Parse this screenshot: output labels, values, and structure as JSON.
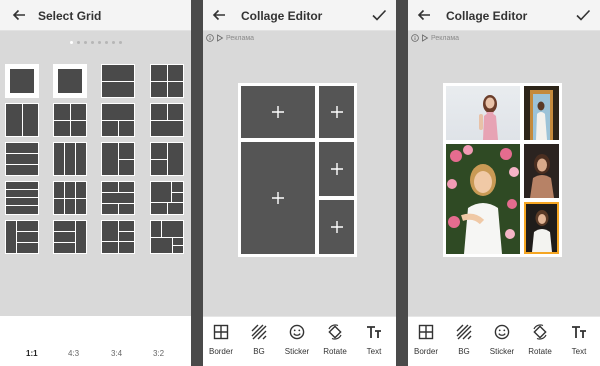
{
  "panels": [
    {
      "title": "Select Grid",
      "ratios": [
        {
          "label": "1:1",
          "active": true
        },
        {
          "label": "4:3",
          "active": false
        },
        {
          "label": "3:4",
          "active": false
        },
        {
          "label": "3:2",
          "active": false
        }
      ],
      "page_dots_count": 8,
      "page_dots_active": 0
    },
    {
      "title": "Collage Editor",
      "ad_label": "Реклама",
      "slot_icon": "plus-icon",
      "tools": [
        {
          "label": "Border",
          "icon": "border-grid-icon"
        },
        {
          "label": "BG",
          "icon": "stripes-icon"
        },
        {
          "label": "Sticker",
          "icon": "smiley-icon"
        },
        {
          "label": "Rotate",
          "icon": "rotate-icon"
        },
        {
          "label": "Text",
          "icon": "text-icon"
        }
      ]
    },
    {
      "title": "Collage Editor",
      "ad_label": "Реклама",
      "tools": [
        {
          "label": "Border",
          "icon": "border-grid-icon"
        },
        {
          "label": "BG",
          "icon": "stripes-icon"
        },
        {
          "label": "Sticker",
          "icon": "smiley-icon"
        },
        {
          "label": "Rotate",
          "icon": "rotate-icon"
        },
        {
          "label": "Text",
          "icon": "text-icon"
        }
      ]
    }
  ],
  "colors": {
    "appbar": "#f4f4f4",
    "workspace": "#d9d9d9",
    "gutter": "#4a4a4a",
    "slot": "#555555",
    "selected_slot_border": "#f5a623"
  }
}
